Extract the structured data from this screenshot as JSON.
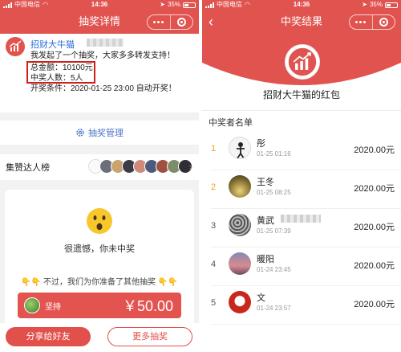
{
  "left": {
    "status": {
      "carrier": "中国电信",
      "time": "14:36",
      "battery": "35%"
    },
    "nav": {
      "title": "抽奖详情"
    },
    "info": {
      "sponsor_name": "招财大牛猫",
      "line1": "我发起了一个抽奖，大家多多转发支持！",
      "line2": "总金额：10100元",
      "line3": "中奖人数：5人",
      "line4": "开奖条件：2020-01-25 23:00 自动开奖！"
    },
    "manage_label": "抽奖管理",
    "rank_label": "集赞达人榜",
    "result": {
      "message": "很遗憾，你未中奖",
      "other_hint": "不过，我们为你准备了其他抽奖",
      "coupon_label": "坚持",
      "coupon_amount": "￥50.00"
    },
    "buttons": {
      "share": "分享给好友",
      "more": "更多抽奖"
    }
  },
  "right": {
    "status": {
      "carrier": "中国电信",
      "time": "14:36",
      "battery": "35%"
    },
    "nav": {
      "title": "中奖结果"
    },
    "packet_title": "招财大牛猫的红包",
    "list_header": "中奖者名单",
    "winners": [
      {
        "rank": "1",
        "name": "彤",
        "time": "01-25 01:16",
        "amount": "2020.00元"
      },
      {
        "rank": "2",
        "name": "王冬",
        "time": "01-25 08:25",
        "amount": "2020.00元"
      },
      {
        "rank": "3",
        "name": "黄武",
        "time": "01-25 07:39",
        "amount": "2020.00元"
      },
      {
        "rank": "4",
        "name": "暖阳",
        "time": "01-24 23:45",
        "amount": "2020.00元"
      },
      {
        "rank": "5",
        "name": "文",
        "time": "01-24 23:57",
        "amount": "2020.00元"
      }
    ]
  },
  "colors": {
    "brand_red": "#e0534f",
    "highlight_box": "#d1201a",
    "link_blue": "#2a6fd6"
  }
}
